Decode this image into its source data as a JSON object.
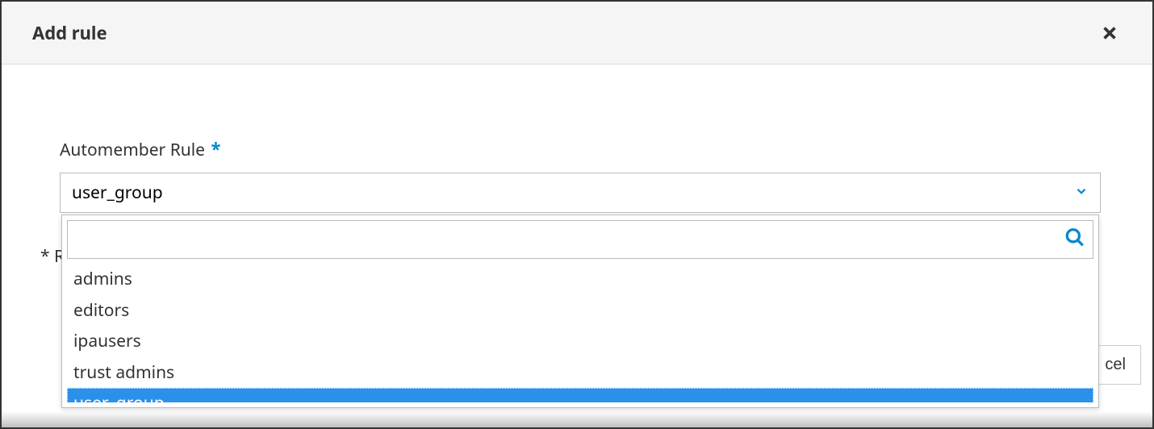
{
  "modal": {
    "title": "Add rule",
    "field_label": "Automember Rule",
    "required_note_prefix": "* R",
    "cancel_peek": "cel"
  },
  "combobox": {
    "selected": "user_group",
    "search_value": "",
    "options": [
      {
        "label": "admins",
        "selected": false
      },
      {
        "label": "editors",
        "selected": false
      },
      {
        "label": "ipausers",
        "selected": false
      },
      {
        "label": "trust admins",
        "selected": false
      },
      {
        "label": "user_group",
        "selected": true
      }
    ]
  }
}
